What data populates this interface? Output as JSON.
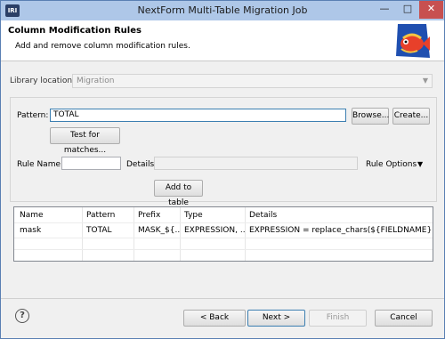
{
  "window": {
    "title": "NextForm Multi-Table Migration Job",
    "app_icon": "IRI",
    "minimize": "—",
    "maximize": "□",
    "close": "✕"
  },
  "header": {
    "title": "Column Modification Rules",
    "subtitle": "Add and remove column modification rules."
  },
  "library": {
    "label": "Library location:",
    "value": "Migration"
  },
  "pattern": {
    "label": "Pattern:",
    "value": "TOTAL",
    "browse_label": "Browse...",
    "create_label": "Create...",
    "test_label": "Test for matches..."
  },
  "rule": {
    "name_label": "Rule Name:",
    "name_value": "",
    "details_label": "Details:",
    "details_value": "",
    "options_label": "Rule Options",
    "add_label": "Add to table"
  },
  "table": {
    "headers": [
      "Name",
      "Pattern",
      "Prefix",
      "Type",
      "Details"
    ],
    "rows": [
      [
        "mask",
        "TOTAL",
        "MASK_${...",
        "EXPRESSION, ...",
        "EXPRESSION = replace_chars(${FIELDNAME}), ..."
      ]
    ]
  },
  "footer": {
    "help": "?",
    "back_label": "< Back",
    "next_label": "Next >",
    "finish_label": "Finish",
    "cancel_label": "Cancel"
  },
  "colors": {
    "title_bar": "#aec7e8",
    "close_button": "#c75050",
    "focus_border": "#3c7fb1"
  }
}
